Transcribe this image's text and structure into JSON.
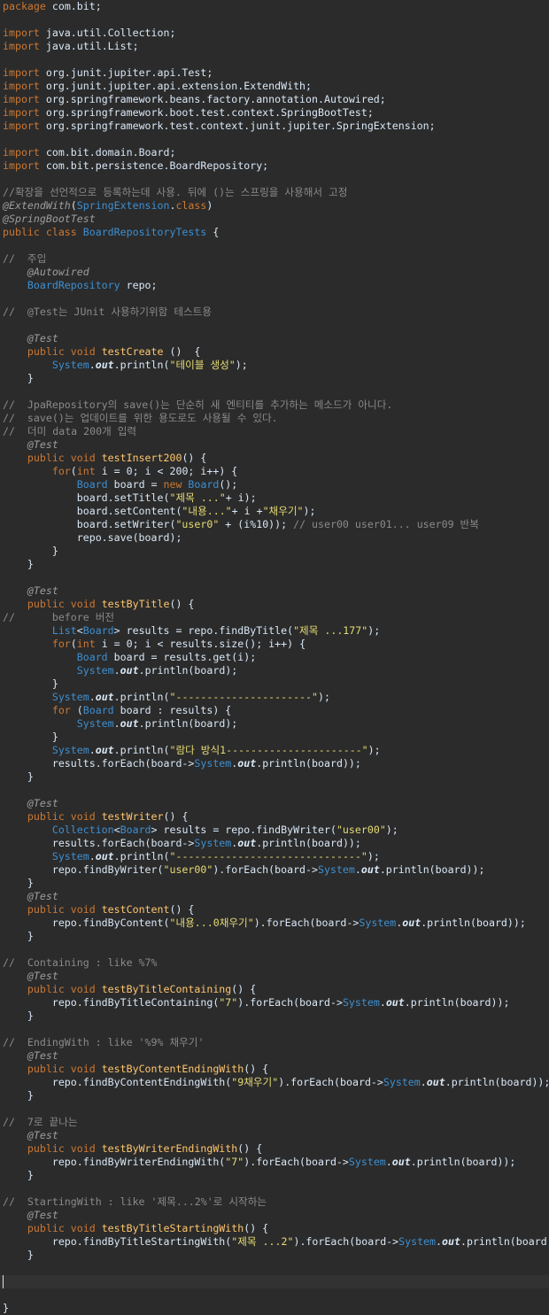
{
  "editor": {
    "colors": {
      "background": "#2b2b2b",
      "current_line": "#323232",
      "keyword": "#cc7832",
      "comment": "#8a8a8a",
      "annotation": "#9e9e9e",
      "string": "#e6db74",
      "type": "#3d8fd1",
      "method": "#ffc66d",
      "text": "#d9e8f7"
    },
    "current_line_index": 96,
    "lines": [
      [
        [
          "kw",
          "package"
        ],
        [
          "pl",
          " com.bit;"
        ]
      ],
      [],
      [
        [
          "kw",
          "import"
        ],
        [
          "pl",
          " java.util.Collection;"
        ]
      ],
      [
        [
          "kw",
          "import"
        ],
        [
          "pl",
          " java.util.List;"
        ]
      ],
      [],
      [
        [
          "kw",
          "import"
        ],
        [
          "pl",
          " org.junit.jupiter.api.Test;"
        ]
      ],
      [
        [
          "kw",
          "import"
        ],
        [
          "pl",
          " org.junit.jupiter.api.extension.ExtendWith;"
        ]
      ],
      [
        [
          "kw",
          "import"
        ],
        [
          "pl",
          " org.springframework.beans.factory.annotation.Autowired;"
        ]
      ],
      [
        [
          "kw",
          "import"
        ],
        [
          "pl",
          " org.springframework.boot.test.context.SpringBootTest;"
        ]
      ],
      [
        [
          "kw",
          "import"
        ],
        [
          "pl",
          " org.springframework.test.context.junit.jupiter.SpringExtension;"
        ]
      ],
      [],
      [
        [
          "kw",
          "import"
        ],
        [
          "pl",
          " com.bit.domain.Board;"
        ]
      ],
      [
        [
          "kw",
          "import"
        ],
        [
          "pl",
          " com.bit.persistence.BoardRepository;"
        ]
      ],
      [],
      [
        [
          "cm",
          "//확장을 선언적으로 등록하는데 사용. 뒤에 ()는 스프링을 사용해서 고정"
        ]
      ],
      [
        [
          "an",
          "@ExtendWith"
        ],
        [
          "pl",
          "("
        ],
        [
          "typ",
          "SpringExtension"
        ],
        [
          "pl",
          "."
        ],
        [
          "kw",
          "class"
        ],
        [
          "pl",
          ")"
        ]
      ],
      [
        [
          "an",
          "@SpringBootTest"
        ]
      ],
      [
        [
          "kw",
          "public class "
        ],
        [
          "typ",
          "BoardRepositoryTests"
        ],
        [
          "pl",
          " {"
        ]
      ],
      [],
      [
        [
          "cm",
          "//  주입"
        ]
      ],
      [
        [
          "pl",
          "    "
        ],
        [
          "an",
          "@Autowired"
        ]
      ],
      [
        [
          "pl",
          "    "
        ],
        [
          "typ",
          "BoardRepository"
        ],
        [
          "pl",
          " repo;"
        ]
      ],
      [],
      [
        [
          "cm",
          "//  @Test는 JUnit 사용하기위함 테스트용"
        ]
      ],
      [],
      [
        [
          "pl",
          "    "
        ],
        [
          "an",
          "@Test"
        ]
      ],
      [
        [
          "pl",
          "    "
        ],
        [
          "kw",
          "public void "
        ],
        [
          "fn",
          "testCreate"
        ],
        [
          "pl",
          " ()  {"
        ]
      ],
      [
        [
          "pl",
          "        "
        ],
        [
          "typ",
          "System"
        ],
        [
          "pl",
          "."
        ],
        [
          "fld",
          "out"
        ],
        [
          "pl",
          ".println("
        ],
        [
          "str",
          "\"테이블 생성\""
        ],
        [
          "pl",
          ");"
        ]
      ],
      [
        [
          "pl",
          "    }"
        ]
      ],
      [],
      [
        [
          "cm",
          "//  JpaRepository의 save()는 단순히 새 엔티티를 추가하는 메소드가 아니다."
        ]
      ],
      [
        [
          "cm",
          "//  save()는 업데이트를 위한 용도로도 사용될 수 있다."
        ]
      ],
      [
        [
          "cm",
          "//  더미 data 200개 입력"
        ]
      ],
      [
        [
          "pl",
          "    "
        ],
        [
          "an",
          "@Test"
        ]
      ],
      [
        [
          "pl",
          "    "
        ],
        [
          "kw",
          "public void "
        ],
        [
          "fn",
          "testInsert200"
        ],
        [
          "pl",
          "() {"
        ]
      ],
      [
        [
          "pl",
          "        "
        ],
        [
          "kw",
          "for"
        ],
        [
          "pl",
          "("
        ],
        [
          "kw",
          "int"
        ],
        [
          "pl",
          " i = 0; i < 200; i++) {"
        ]
      ],
      [
        [
          "pl",
          "            "
        ],
        [
          "typ",
          "Board"
        ],
        [
          "pl",
          " board = "
        ],
        [
          "kw",
          "new "
        ],
        [
          "typ",
          "Board"
        ],
        [
          "pl",
          "();"
        ]
      ],
      [
        [
          "pl",
          "            board.setTitle("
        ],
        [
          "str",
          "\"제목 ...\""
        ],
        [
          "pl",
          "+ i);"
        ]
      ],
      [
        [
          "pl",
          "            board.setContent("
        ],
        [
          "str",
          "\"내용...\""
        ],
        [
          "pl",
          "+ i +"
        ],
        [
          "str",
          "\"채우기\""
        ],
        [
          "pl",
          ");"
        ]
      ],
      [
        [
          "pl",
          "            board.setWriter("
        ],
        [
          "str",
          "\"user0\""
        ],
        [
          "pl",
          " + (i%10)); "
        ],
        [
          "cm",
          "// user00 user01... user09 반복"
        ]
      ],
      [
        [
          "pl",
          "            repo.save(board);"
        ]
      ],
      [
        [
          "pl",
          "        }"
        ]
      ],
      [
        [
          "pl",
          "    }"
        ]
      ],
      [],
      [
        [
          "pl",
          "    "
        ],
        [
          "an",
          "@Test"
        ]
      ],
      [
        [
          "pl",
          "    "
        ],
        [
          "kw",
          "public void "
        ],
        [
          "fn",
          "testByTitle"
        ],
        [
          "pl",
          "() {"
        ]
      ],
      [
        [
          "cm",
          "//      before 버전"
        ]
      ],
      [
        [
          "pl",
          "        "
        ],
        [
          "typ",
          "List"
        ],
        [
          "pl",
          "<"
        ],
        [
          "typ",
          "Board"
        ],
        [
          "pl",
          "> results = repo.findByTitle("
        ],
        [
          "str",
          "\"제목 ...177\""
        ],
        [
          "pl",
          ");"
        ]
      ],
      [
        [
          "pl",
          "        "
        ],
        [
          "kw",
          "for"
        ],
        [
          "pl",
          "("
        ],
        [
          "kw",
          "int"
        ],
        [
          "pl",
          " i = 0; i < results.size(); i++) {"
        ]
      ],
      [
        [
          "pl",
          "            "
        ],
        [
          "typ",
          "Board"
        ],
        [
          "pl",
          " board = results.get(i);"
        ]
      ],
      [
        [
          "pl",
          "            "
        ],
        [
          "typ",
          "System"
        ],
        [
          "pl",
          "."
        ],
        [
          "fld",
          "out"
        ],
        [
          "pl",
          ".println(board);"
        ]
      ],
      [
        [
          "pl",
          "        }"
        ]
      ],
      [
        [
          "pl",
          "        "
        ],
        [
          "typ",
          "System"
        ],
        [
          "pl",
          "."
        ],
        [
          "fld",
          "out"
        ],
        [
          "pl",
          ".println("
        ],
        [
          "str",
          "\"----------------------\""
        ],
        [
          "pl",
          ");"
        ]
      ],
      [
        [
          "pl",
          "        "
        ],
        [
          "kw",
          "for"
        ],
        [
          "pl",
          " ("
        ],
        [
          "typ",
          "Board"
        ],
        [
          "pl",
          " board : results) {"
        ]
      ],
      [
        [
          "pl",
          "            "
        ],
        [
          "typ",
          "System"
        ],
        [
          "pl",
          "."
        ],
        [
          "fld",
          "out"
        ],
        [
          "pl",
          ".println(board);"
        ]
      ],
      [
        [
          "pl",
          "        }"
        ]
      ],
      [
        [
          "pl",
          "        "
        ],
        [
          "typ",
          "System"
        ],
        [
          "pl",
          "."
        ],
        [
          "fld",
          "out"
        ],
        [
          "pl",
          ".println("
        ],
        [
          "str",
          "\"람다 방식1----------------------\""
        ],
        [
          "pl",
          ");"
        ]
      ],
      [
        [
          "pl",
          "        results.forEach(board->"
        ],
        [
          "typ",
          "System"
        ],
        [
          "pl",
          "."
        ],
        [
          "fld",
          "out"
        ],
        [
          "pl",
          ".println(board));"
        ]
      ],
      [
        [
          "pl",
          "    }"
        ]
      ],
      [],
      [
        [
          "pl",
          "    "
        ],
        [
          "an",
          "@Test"
        ]
      ],
      [
        [
          "pl",
          "    "
        ],
        [
          "kw",
          "public void "
        ],
        [
          "fn",
          "testWriter"
        ],
        [
          "pl",
          "() {"
        ]
      ],
      [
        [
          "pl",
          "        "
        ],
        [
          "typ",
          "Collection"
        ],
        [
          "pl",
          "<"
        ],
        [
          "typ",
          "Board"
        ],
        [
          "pl",
          "> results = repo.findByWriter("
        ],
        [
          "str",
          "\"user00\""
        ],
        [
          "pl",
          ");"
        ]
      ],
      [
        [
          "pl",
          "        results.forEach(board->"
        ],
        [
          "typ",
          "System"
        ],
        [
          "pl",
          "."
        ],
        [
          "fld",
          "out"
        ],
        [
          "pl",
          ".println(board));"
        ]
      ],
      [
        [
          "pl",
          "        "
        ],
        [
          "typ",
          "System"
        ],
        [
          "pl",
          "."
        ],
        [
          "fld",
          "out"
        ],
        [
          "pl",
          ".println("
        ],
        [
          "str",
          "\"------------------------------\""
        ],
        [
          "pl",
          ");"
        ]
      ],
      [
        [
          "pl",
          "        repo.findByWriter("
        ],
        [
          "str",
          "\"user00\""
        ],
        [
          "pl",
          ").forEach(board->"
        ],
        [
          "typ",
          "System"
        ],
        [
          "pl",
          "."
        ],
        [
          "fld",
          "out"
        ],
        [
          "pl",
          ".println(board));"
        ]
      ],
      [
        [
          "pl",
          "    }"
        ]
      ],
      [
        [
          "pl",
          "    "
        ],
        [
          "an",
          "@Test"
        ]
      ],
      [
        [
          "pl",
          "    "
        ],
        [
          "kw",
          "public void "
        ],
        [
          "fn",
          "testContent"
        ],
        [
          "pl",
          "() {"
        ]
      ],
      [
        [
          "pl",
          "        repo.findByContent("
        ],
        [
          "str",
          "\"내용...0채우기\""
        ],
        [
          "pl",
          ").forEach(board->"
        ],
        [
          "typ",
          "System"
        ],
        [
          "pl",
          "."
        ],
        [
          "fld",
          "out"
        ],
        [
          "pl",
          ".println(board));"
        ]
      ],
      [
        [
          "pl",
          "    }"
        ]
      ],
      [],
      [
        [
          "cm",
          "//  Containing : like %7%"
        ]
      ],
      [
        [
          "pl",
          "    "
        ],
        [
          "an",
          "@Test"
        ]
      ],
      [
        [
          "pl",
          "    "
        ],
        [
          "kw",
          "public void "
        ],
        [
          "fn",
          "testByTitleContaining"
        ],
        [
          "pl",
          "() {"
        ]
      ],
      [
        [
          "pl",
          "        repo.findByTitleContaining("
        ],
        [
          "str",
          "\"7\""
        ],
        [
          "pl",
          ").forEach(board->"
        ],
        [
          "typ",
          "System"
        ],
        [
          "pl",
          "."
        ],
        [
          "fld",
          "out"
        ],
        [
          "pl",
          ".println(board));"
        ]
      ],
      [
        [
          "pl",
          "    }"
        ]
      ],
      [],
      [
        [
          "cm",
          "//  EndingWith : like '%9% 채우기'"
        ]
      ],
      [
        [
          "pl",
          "    "
        ],
        [
          "an",
          "@Test"
        ]
      ],
      [
        [
          "pl",
          "    "
        ],
        [
          "kw",
          "public void "
        ],
        [
          "fn",
          "testByContentEndingWith"
        ],
        [
          "pl",
          "() {"
        ]
      ],
      [
        [
          "pl",
          "        repo.findByContentEndingWith("
        ],
        [
          "str",
          "\"9채우기\""
        ],
        [
          "pl",
          ").forEach(board->"
        ],
        [
          "typ",
          "System"
        ],
        [
          "pl",
          "."
        ],
        [
          "fld",
          "out"
        ],
        [
          "pl",
          ".println(board));"
        ]
      ],
      [
        [
          "pl",
          "    }"
        ]
      ],
      [],
      [
        [
          "cm",
          "//  7로 끝나는"
        ]
      ],
      [
        [
          "pl",
          "    "
        ],
        [
          "an",
          "@Test"
        ]
      ],
      [
        [
          "pl",
          "    "
        ],
        [
          "kw",
          "public void "
        ],
        [
          "fn",
          "testByWriterEndingWith"
        ],
        [
          "pl",
          "() {"
        ]
      ],
      [
        [
          "pl",
          "        repo.findByWriterEndingWith("
        ],
        [
          "str",
          "\"7\""
        ],
        [
          "pl",
          ").forEach(board->"
        ],
        [
          "typ",
          "System"
        ],
        [
          "pl",
          "."
        ],
        [
          "fld",
          "out"
        ],
        [
          "pl",
          ".println(board));"
        ]
      ],
      [
        [
          "pl",
          "    }"
        ]
      ],
      [],
      [
        [
          "cm",
          "//  StartingWith : like '제목...2%'로 시작하는"
        ]
      ],
      [
        [
          "pl",
          "    "
        ],
        [
          "an",
          "@Test"
        ]
      ],
      [
        [
          "pl",
          "    "
        ],
        [
          "kw",
          "public void "
        ],
        [
          "fn",
          "testByTitleStartingWith"
        ],
        [
          "pl",
          "() {"
        ]
      ],
      [
        [
          "pl",
          "        repo.findByTitleStartingWith("
        ],
        [
          "str",
          "\"제목 ...2\""
        ],
        [
          "pl",
          ").forEach(board->"
        ],
        [
          "typ",
          "System"
        ],
        [
          "pl",
          "."
        ],
        [
          "fld",
          "out"
        ],
        [
          "pl",
          ".println(board)"
        ]
      ],
      [
        [
          "pl",
          "    }"
        ]
      ],
      [],
      [],
      [],
      [
        [
          "pl",
          "}"
        ]
      ]
    ]
  }
}
